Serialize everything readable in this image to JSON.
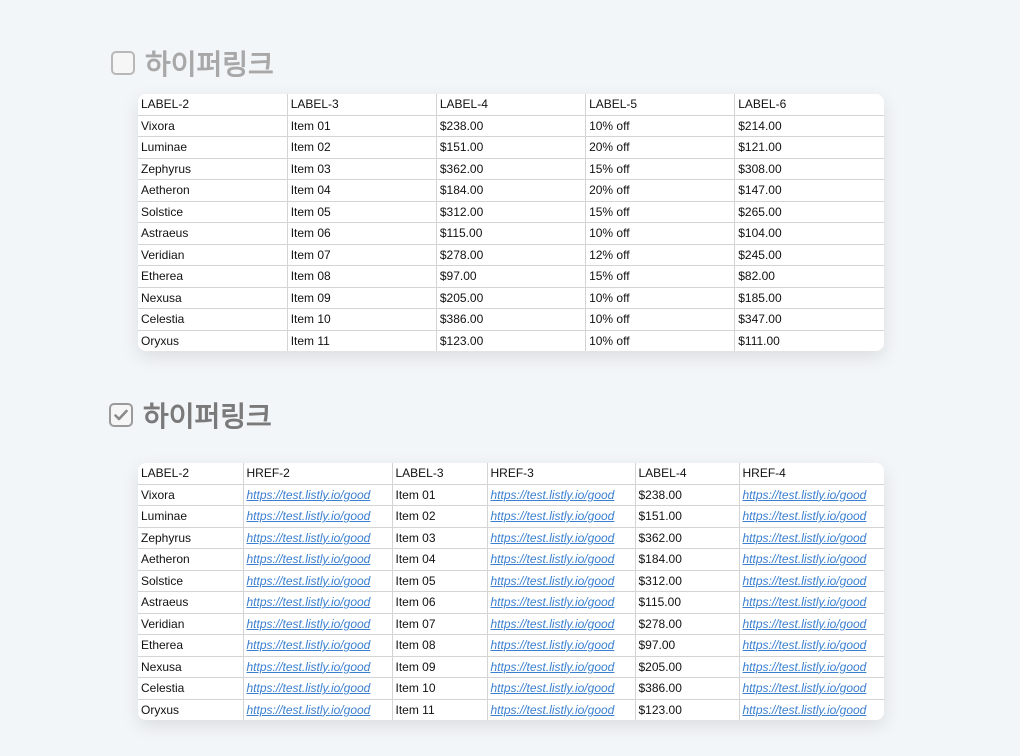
{
  "section1": {
    "title": "하이퍼링크",
    "checked": false,
    "headers": [
      "LABEL-2",
      "LABEL-3",
      "LABEL-4",
      "LABEL-5",
      "LABEL-6"
    ],
    "rows": [
      [
        "Vixora",
        "Item 01",
        "$238.00",
        "10% off",
        "$214.00"
      ],
      [
        "Luminae",
        "Item 02",
        "$151.00",
        "20% off",
        "$121.00"
      ],
      [
        "Zephyrus",
        "Item 03",
        "$362.00",
        "15% off",
        "$308.00"
      ],
      [
        "Aetheron",
        "Item 04",
        "$184.00",
        "20% off",
        "$147.00"
      ],
      [
        "Solstice",
        "Item 05",
        "$312.00",
        "15% off",
        "$265.00"
      ],
      [
        "Astraeus",
        "Item 06",
        "$115.00",
        "10% off",
        "$104.00"
      ],
      [
        "Veridian",
        "Item 07",
        "$278.00",
        "12% off",
        "$245.00"
      ],
      [
        "Etherea",
        "Item 08",
        "$97.00",
        "15% off",
        "$82.00"
      ],
      [
        "Nexusa",
        "Item 09",
        "$205.00",
        "10% off",
        "$185.00"
      ],
      [
        "Celestia",
        "Item 10",
        "$386.00",
        "10% off",
        "$347.00"
      ],
      [
        "Oryxus",
        "Item 11",
        "$123.00",
        "10% off",
        "$111.00"
      ]
    ]
  },
  "section2": {
    "title": "하이퍼링크",
    "checked": true,
    "headers": [
      "LABEL-2",
      "HREF-2",
      "LABEL-3",
      "HREF-3",
      "LABEL-4",
      "HREF-4"
    ],
    "link_text": "https://test.listly.io/good",
    "rows": [
      [
        "Vixora",
        "https://test.listly.io/good",
        "Item 01",
        "https://test.listly.io/good",
        "$238.00",
        "https://test.listly.io/good"
      ],
      [
        "Luminae",
        "https://test.listly.io/good",
        "Item 02",
        "https://test.listly.io/good",
        "$151.00",
        "https://test.listly.io/good"
      ],
      [
        "Zephyrus",
        "https://test.listly.io/good",
        "Item 03",
        "https://test.listly.io/good",
        "$362.00",
        "https://test.listly.io/good"
      ],
      [
        "Aetheron",
        "https://test.listly.io/good",
        "Item 04",
        "https://test.listly.io/good",
        "$184.00",
        "https://test.listly.io/good"
      ],
      [
        "Solstice",
        "https://test.listly.io/good",
        "Item 05",
        "https://test.listly.io/good",
        "$312.00",
        "https://test.listly.io/good"
      ],
      [
        "Astraeus",
        "https://test.listly.io/good",
        "Item 06",
        "https://test.listly.io/good",
        "$115.00",
        "https://test.listly.io/good"
      ],
      [
        "Veridian",
        "https://test.listly.io/good",
        "Item 07",
        "https://test.listly.io/good",
        "$278.00",
        "https://test.listly.io/good"
      ],
      [
        "Etherea",
        "https://test.listly.io/good",
        "Item 08",
        "https://test.listly.io/good",
        "$97.00",
        "https://test.listly.io/good"
      ],
      [
        "Nexusa",
        "https://test.listly.io/good",
        "Item 09",
        "https://test.listly.io/good",
        "$205.00",
        "https://test.listly.io/good"
      ],
      [
        "Celestia",
        "https://test.listly.io/good",
        "Item 10",
        "https://test.listly.io/good",
        "$386.00",
        "https://test.listly.io/good"
      ],
      [
        "Oryxus",
        "https://test.listly.io/good",
        "Item 11",
        "https://test.listly.io/good",
        "$123.00",
        "https://test.listly.io/good"
      ]
    ]
  }
}
